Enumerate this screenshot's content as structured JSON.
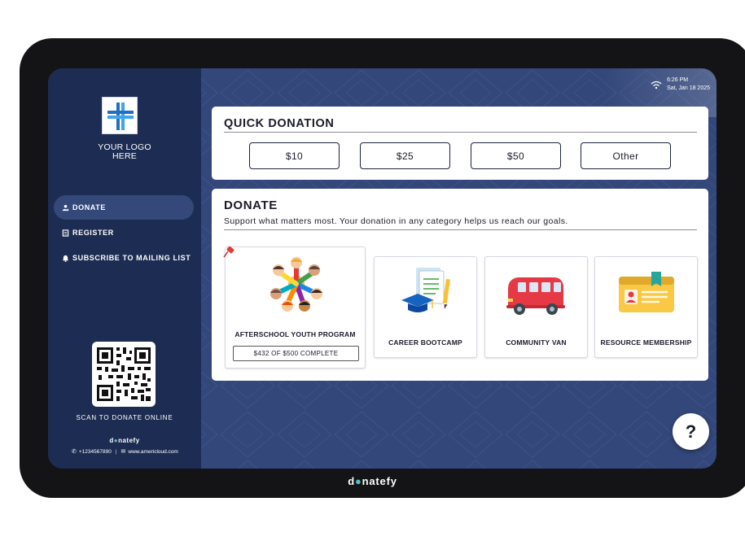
{
  "status": {
    "time": "6:26 PM",
    "date": "Sat, Jan 18 2025",
    "icon": "wifi-icon"
  },
  "sidebar": {
    "logo_line1": "YOUR LOGO",
    "logo_line2": "HERE",
    "items": [
      {
        "label": "DONATE",
        "icon": "donate-hand-icon",
        "active": true
      },
      {
        "label": "REGISTER",
        "icon": "register-icon",
        "active": false
      },
      {
        "label": "SUBSCRIBE TO MAILING LIST",
        "icon": "bell-icon",
        "active": false
      }
    ],
    "scan_label": "SCAN TO DONATE ONLINE",
    "brand_pre": "d",
    "brand_post": "natefy",
    "phone": "+1234567890",
    "website": "www.americloud.com"
  },
  "quick": {
    "title": "QUICK DONATION",
    "amounts": [
      "$10",
      "$25",
      "$50",
      "Other"
    ]
  },
  "donate": {
    "title": "DONATE",
    "subtitle": "Support what matters most. Your donation in any category helps us reach our goals.",
    "categories": [
      {
        "label": "AFTERSCHOOL YOUTH PROGRAM",
        "progress_text": "$432 OF $500 COMPLETE",
        "raised": 432,
        "goal": 500,
        "pinned": true
      },
      {
        "label": "CAREER BOOTCAMP"
      },
      {
        "label": "COMMUNITY VAN"
      },
      {
        "label": "RESOURCE MEMBERSHIP"
      }
    ]
  },
  "help_label": "?",
  "device_brand_pre": "d",
  "device_brand_post": "natefy",
  "colors": {
    "sidebar": "#1d2c52",
    "background": "#33477a",
    "active_nav": "#34487a",
    "brand_accent": "#4fc1c4"
  }
}
